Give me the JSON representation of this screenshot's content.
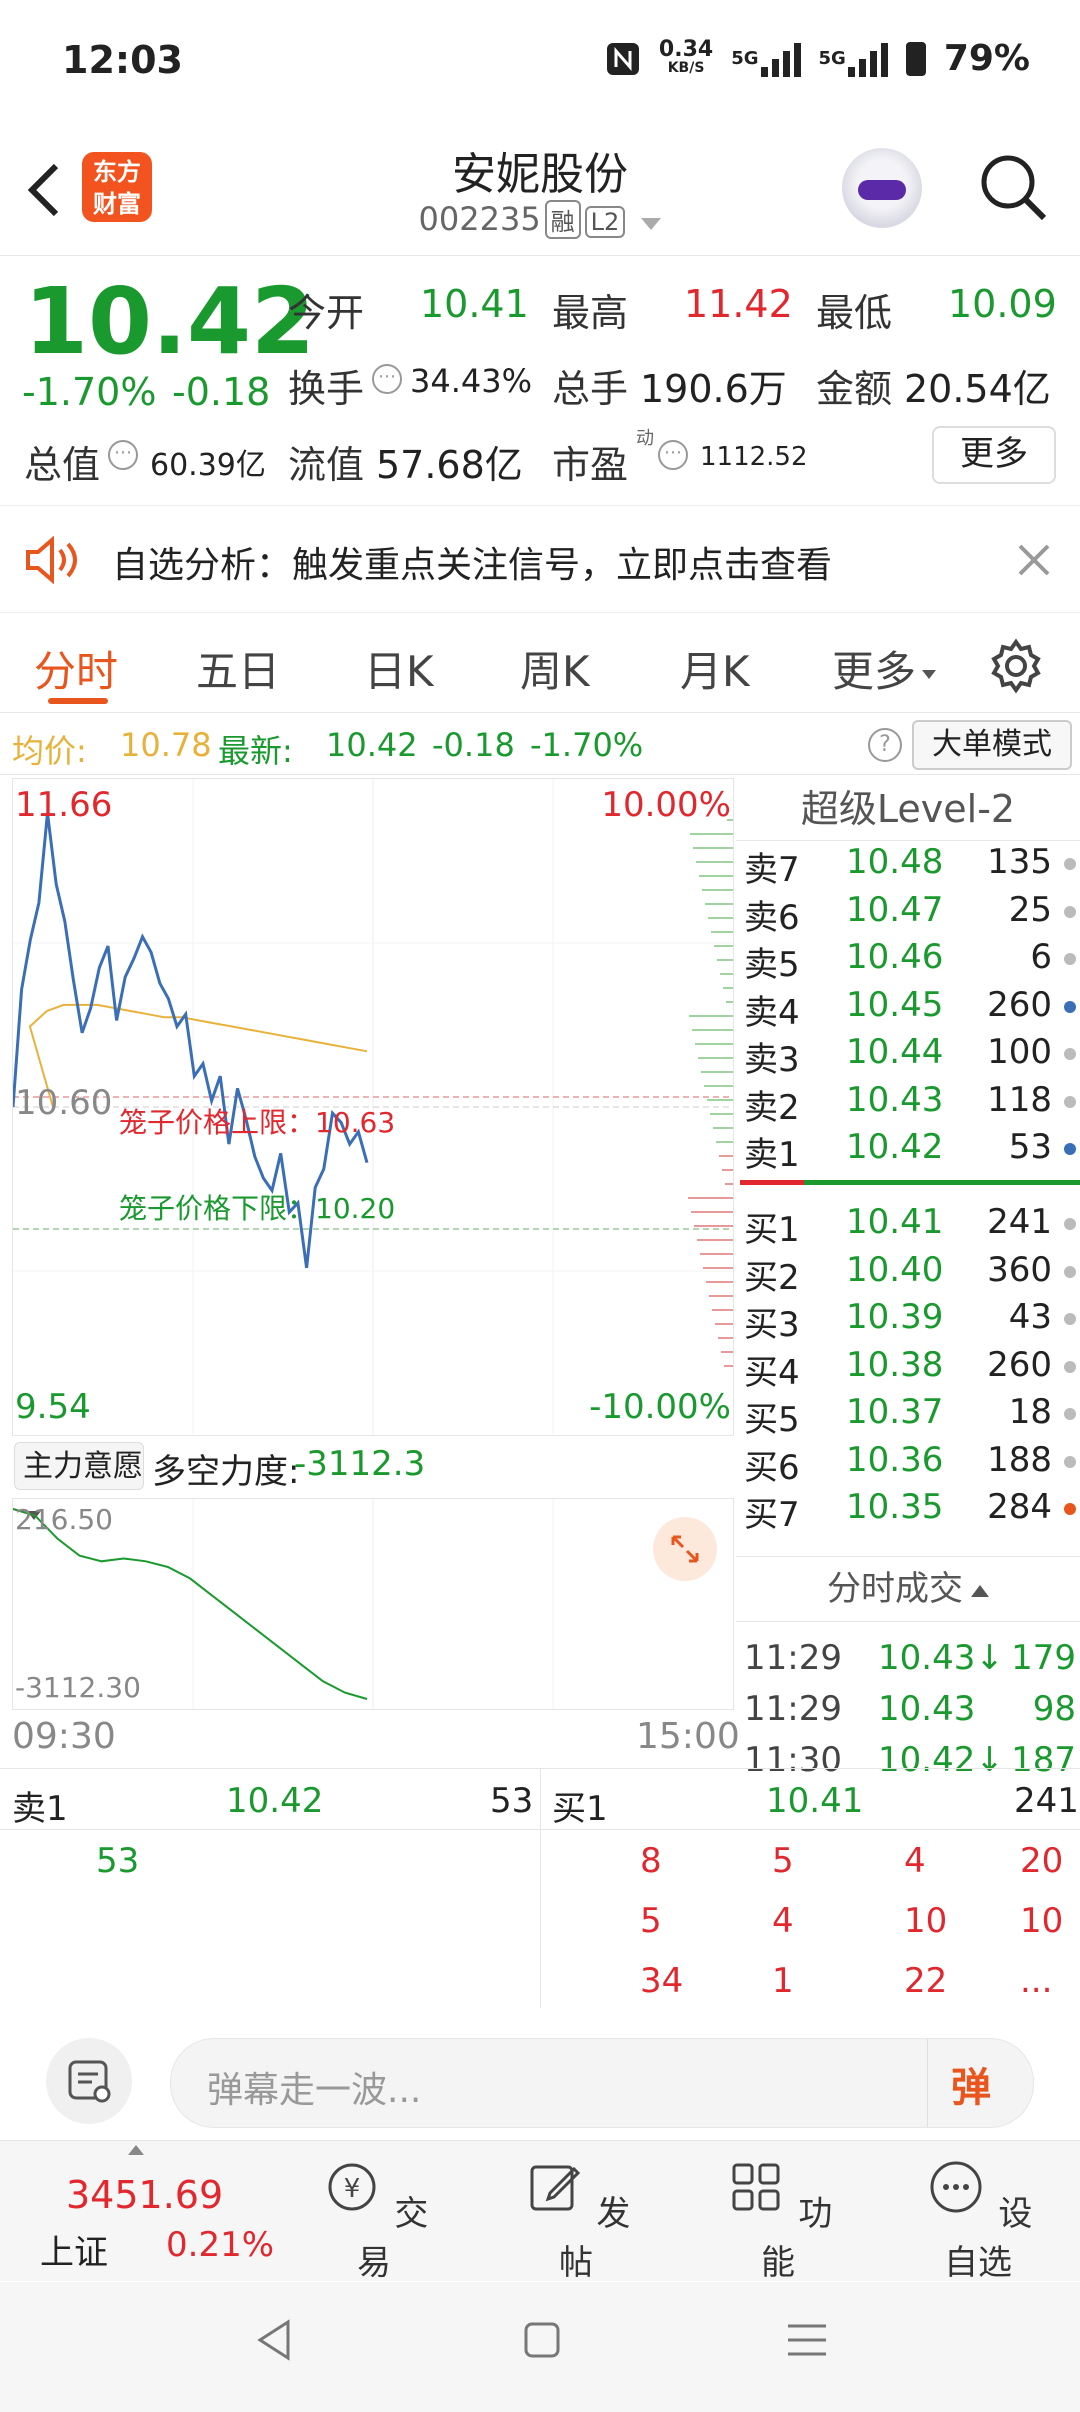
{
  "status": {
    "time": "12:03",
    "net_speed": "0.34",
    "net_unit": "KB/S",
    "sig1": "5G",
    "sig2": "5G",
    "battery": "79%"
  },
  "header": {
    "title": "安妮股份",
    "code": "002235",
    "tag1": "融",
    "tag2": "L2",
    "logo_line1": "东方",
    "logo_line2": "财富"
  },
  "quote": {
    "price": "10.42",
    "change_pct": "-1.70%",
    "change": "-0.18",
    "open_label": "今开",
    "open": "10.41",
    "high_label": "最高",
    "high": "11.42",
    "low_label": "最低",
    "low": "10.09",
    "turnover_label": "换手",
    "turnover": "34.43%",
    "volume_label": "总手",
    "volume": "190.6万",
    "amount_label": "金额",
    "amount": "20.54亿",
    "mktcap_label": "总值",
    "mktcap": "60.39亿",
    "float_label": "流值",
    "float": "57.68亿",
    "pe_label": "市盈",
    "pe_sup": "动",
    "pe": "1112.52",
    "more": "更多"
  },
  "notice": {
    "text": "自选分析：触发重点关注信号，立即点击查看"
  },
  "tabs": [
    "分时",
    "五日",
    "日K",
    "周K",
    "月K",
    "更多"
  ],
  "info": {
    "avg_label": "均价:",
    "avg": "10.78",
    "latest_label": "最新:",
    "latest": "10.42",
    "chg": "-0.18",
    "pct": "-1.70%",
    "mode": "大单模式"
  },
  "chart": {
    "y_top": "11.66",
    "y_mid": "10.60",
    "y_bot": "9.54",
    "pct_top": "10.00%",
    "pct_bot": "-10.00%",
    "upper_label": "笼子价格上限：10.63",
    "lower_label": "笼子价格下限：10.20",
    "sub_selector": "主力意愿",
    "sub_label": "多空力度:",
    "sub_value": "-3112.3",
    "sub_top": "216.50",
    "sub_bot": "-3112.30",
    "time_start": "09:30",
    "time_end": "15:00"
  },
  "chart_data": {
    "type": "line",
    "y_range": [
      9.54,
      11.66
    ],
    "series": [
      {
        "name": "最新",
        "color": "#3a6fb8",
        "values": [
          10.6,
          10.98,
          11.14,
          11.26,
          11.55,
          11.32,
          11.2,
          11.01,
          10.84,
          10.92,
          11.05,
          11.12,
          10.88,
          11.02,
          11.08,
          11.15,
          11.1,
          11.0,
          10.95,
          10.86,
          10.9,
          10.7,
          10.74,
          10.62,
          10.7,
          10.48,
          10.66,
          10.56,
          10.44,
          10.37,
          10.33,
          10.45,
          10.26,
          10.29,
          10.08,
          10.34,
          10.4,
          10.58,
          10.55,
          10.48,
          10.52,
          10.42
        ]
      },
      {
        "name": "均价",
        "color": "#e8b23a",
        "values": [
          10.6,
          10.86,
          10.91,
          10.93,
          10.93,
          10.93,
          10.92,
          10.91,
          10.9,
          10.89,
          10.89,
          10.88,
          10.87,
          10.86,
          10.85,
          10.84,
          10.83,
          10.82,
          10.81,
          10.8,
          10.79,
          10.78
        ]
      }
    ],
    "sub_series": {
      "name": "多空力度",
      "values": [
        216.5,
        100,
        -300,
        -600,
        -700,
        -650,
        -700,
        -800,
        -1000,
        -1300,
        -1600,
        -1900,
        -2200,
        -2500,
        -2800,
        -3000,
        -3112.3
      ]
    }
  },
  "orderbook": {
    "title": "超级Level-2",
    "sells": [
      {
        "label": "卖7",
        "price": "10.48",
        "vol": "135",
        "dot": "#bbb"
      },
      {
        "label": "卖6",
        "price": "10.47",
        "vol": "25",
        "dot": "#bbb"
      },
      {
        "label": "卖5",
        "price": "10.46",
        "vol": "6",
        "dot": "#bbb"
      },
      {
        "label": "卖4",
        "price": "10.45",
        "vol": "260",
        "dot": "#3a6fb8"
      },
      {
        "label": "卖3",
        "price": "10.44",
        "vol": "100",
        "dot": "#bbb"
      },
      {
        "label": "卖2",
        "price": "10.43",
        "vol": "118",
        "dot": "#bbb"
      },
      {
        "label": "卖1",
        "price": "10.42",
        "vol": "53",
        "dot": "#3a6fb8"
      }
    ],
    "buys": [
      {
        "label": "买1",
        "price": "10.41",
        "vol": "241",
        "dot": "#bbb"
      },
      {
        "label": "买2",
        "price": "10.40",
        "vol": "360",
        "dot": "#bbb"
      },
      {
        "label": "买3",
        "price": "10.39",
        "vol": "43",
        "dot": "#bbb"
      },
      {
        "label": "买4",
        "price": "10.38",
        "vol": "260",
        "dot": "#bbb"
      },
      {
        "label": "买5",
        "price": "10.37",
        "vol": "18",
        "dot": "#bbb"
      },
      {
        "label": "买6",
        "price": "10.36",
        "vol": "188",
        "dot": "#bbb"
      },
      {
        "label": "买7",
        "price": "10.35",
        "vol": "284",
        "dot": "#e8561e"
      }
    ],
    "ticks_title": "分时成交",
    "ticks": [
      {
        "time": "11:29",
        "price": "10.43",
        "arrow": "↓",
        "vol": "179"
      },
      {
        "time": "11:29",
        "price": "10.43",
        "arrow": "",
        "vol": "98"
      },
      {
        "time": "11:30",
        "price": "10.42",
        "arrow": "↓",
        "vol": "187"
      }
    ]
  },
  "queue": {
    "sell_label": "卖1",
    "sell_price": "10.42",
    "sell_total": "53",
    "buy_label": "买1",
    "buy_price": "10.41",
    "buy_total": "241",
    "sell_orders": [
      "53"
    ],
    "buy_orders": [
      "8",
      "5",
      "4",
      "20",
      "5",
      "4",
      "10",
      "10",
      "34",
      "1",
      "22",
      "..."
    ]
  },
  "comment": {
    "placeholder": "弹幕走一波...",
    "danmu": "弹"
  },
  "nav": {
    "index_value": "3451.69",
    "index_name": "上证",
    "index_pct": "0.21%",
    "items": [
      "交易",
      "发帖",
      "功能",
      "设自选"
    ]
  }
}
